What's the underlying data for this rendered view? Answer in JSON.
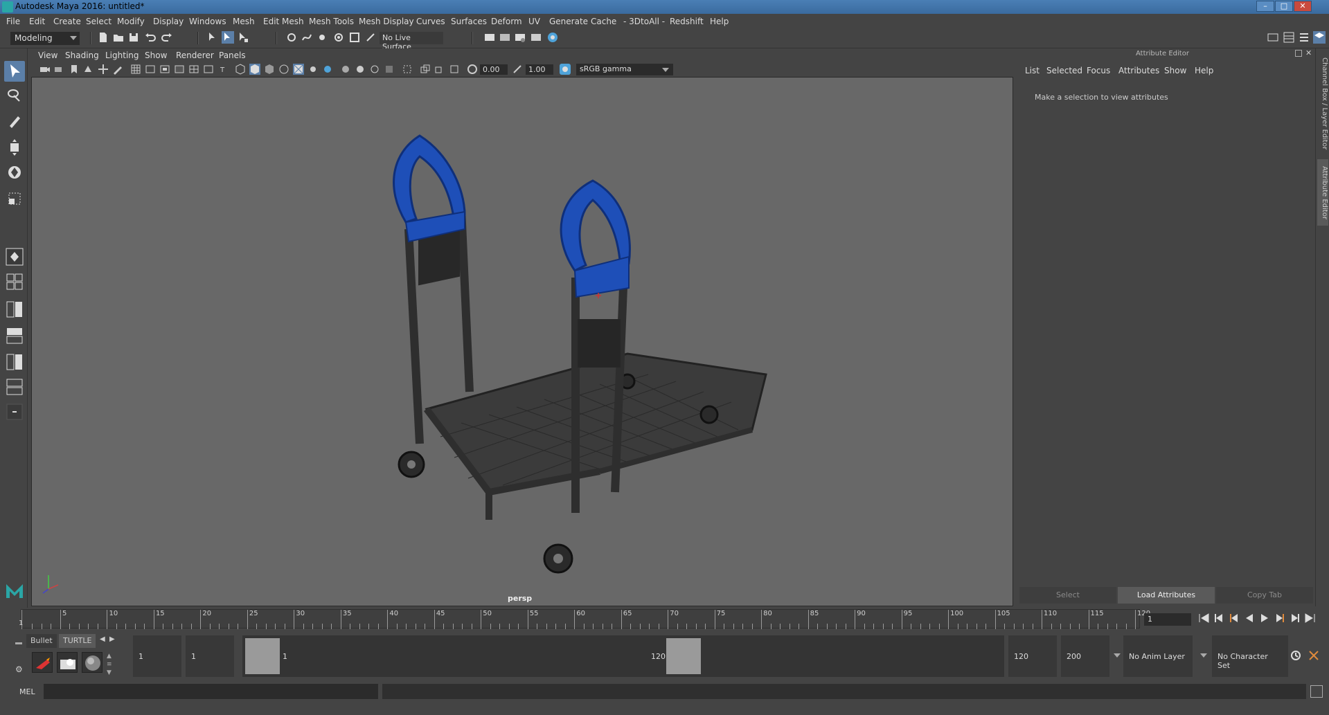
{
  "titlebar": {
    "title": "Autodesk Maya 2016: untitled*"
  },
  "menubar": {
    "items": [
      "File",
      "Edit",
      "Create",
      "Select",
      "Modify",
      "Display",
      "Windows",
      "Mesh",
      "Edit Mesh",
      "Mesh Tools",
      "Mesh Display",
      "Curves",
      "Surfaces",
      "Deform",
      "UV",
      "Generate",
      "Cache",
      "- 3DtoAll -",
      "Redshift",
      "Help"
    ]
  },
  "toolbar": {
    "mode": "Modeling",
    "live_surface": "No Live Surface"
  },
  "viewport": {
    "menu": [
      "View",
      "Shading",
      "Lighting",
      "Show",
      "Renderer",
      "Panels"
    ],
    "exposure": "0.00",
    "gamma_value": "1.00",
    "color_space": "sRGB gamma",
    "camera_label": "persp"
  },
  "attribute_editor": {
    "title": "Attribute Editor",
    "menu": [
      "List",
      "Selected",
      "Focus",
      "Attributes",
      "Show",
      "Help"
    ],
    "message": "Make a selection to view attributes",
    "buttons": {
      "select": "Select",
      "load": "Load Attributes",
      "copy": "Copy Tab"
    }
  },
  "side_tabs": {
    "channel_box": "Channel Box / Layer Editor",
    "attribute_editor": "Attribute Editor"
  },
  "timeline": {
    "start_marker": "1",
    "ticks": [
      "5",
      "10",
      "15",
      "20",
      "25",
      "30",
      "35",
      "40",
      "45",
      "50",
      "55",
      "60",
      "65",
      "70",
      "75",
      "80",
      "85",
      "90",
      "95",
      "100",
      "105",
      "110",
      "115",
      "120"
    ],
    "current_frame": "1"
  },
  "range": {
    "shelf_tabs": [
      "Bullet",
      "TURTLE"
    ],
    "start_time": "1",
    "playback_start": "1",
    "range_start_label": "1",
    "range_end_label": "120",
    "playback_end": "120",
    "end_time": "200",
    "anim_layer": "No Anim Layer",
    "character_set": "No Character Set"
  },
  "cmdline": {
    "label": "MEL"
  },
  "colors": {
    "accent": "#5b7fa8",
    "handle_blue": "#1e4fb8",
    "viewport_bg": "#686868"
  }
}
